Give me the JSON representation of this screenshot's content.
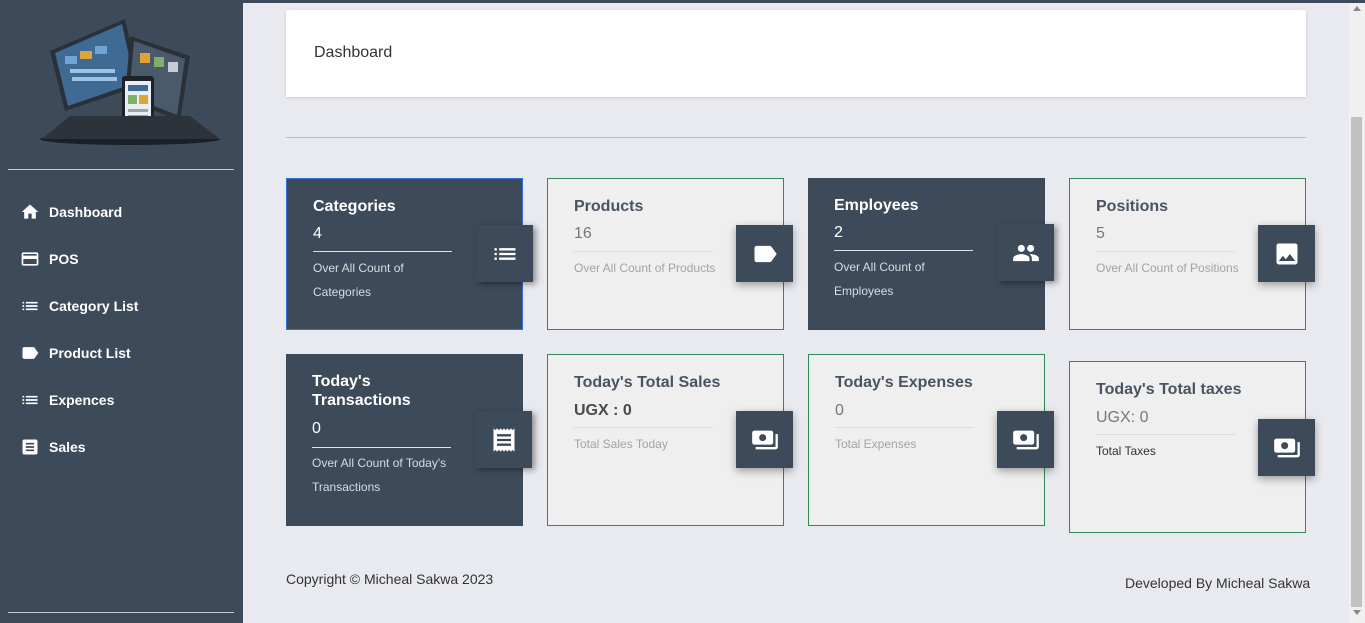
{
  "header": {
    "title": "Dashboard"
  },
  "sidebar": {
    "items": [
      {
        "label": "Dashboard",
        "icon": "home-icon"
      },
      {
        "label": "POS",
        "icon": "credit-card-icon"
      },
      {
        "label": "Category List",
        "icon": "list-icon"
      },
      {
        "label": "Product List",
        "icon": "label-tag-icon"
      },
      {
        "label": "Expences",
        "icon": "list-icon"
      },
      {
        "label": "Sales",
        "icon": "receipt-icon"
      }
    ]
  },
  "cards": [
    {
      "title": "Categories",
      "value": "4",
      "desc": "Over All Count of Categories",
      "icon": "list-icon"
    },
    {
      "title": "Products",
      "value": "16",
      "desc": "Over All Count of Products",
      "icon": "label-tag-icon"
    },
    {
      "title": "Employees",
      "value": "2",
      "desc": "Over All Count of Employees",
      "icon": "people-icon"
    },
    {
      "title": "Positions",
      "value": "5",
      "desc": "Over All Count of Positions",
      "icon": "image-icon"
    },
    {
      "title": "Today's Transactions",
      "value": "0",
      "desc": "Over All Count of Today's Transactions",
      "icon": "receipt-icon"
    },
    {
      "title": "Today's Total Sales",
      "value": "UGX : 0",
      "desc": "Total Sales Today",
      "icon": "money-icon"
    },
    {
      "title": "Today's Expenses",
      "value": "0",
      "desc": "Total Expenses",
      "icon": "money-icon"
    },
    {
      "title": "Today's Total taxes",
      "value": "UGX: 0",
      "desc": "Total Taxes",
      "icon": "money-icon"
    }
  ],
  "footer": {
    "copyright": "Copyright © Micheal Sakwa 2023",
    "developer": "Developed By Micheal Sakwa"
  },
  "colors": {
    "sidebar_bg": "#3d4a5a",
    "page_bg": "#e8eaef",
    "card_border": "#2e8b57",
    "selected_border": "#2f6fd6"
  }
}
